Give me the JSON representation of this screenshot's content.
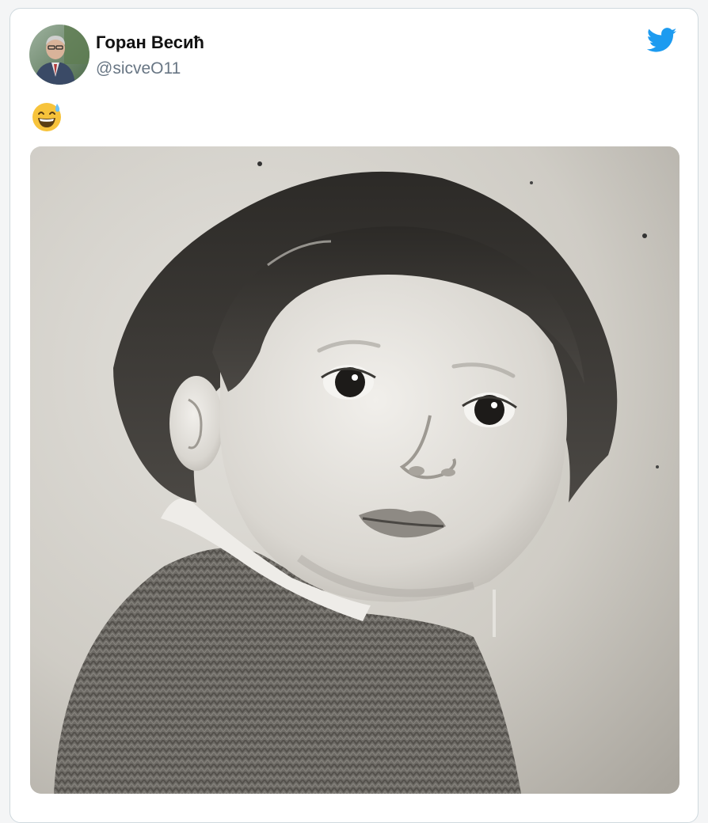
{
  "tweet": {
    "author": {
      "display_name": "Горан Весић",
      "handle": "@sicveO11"
    },
    "text_emoji": "grinning-face-with-sweat",
    "photo": {
      "subject": "black-and-white-photo"
    }
  },
  "colors": {
    "twitter_blue": "#1d9bf0",
    "handle_gray": "#687684",
    "card_border": "#cfd9de"
  },
  "icons": {
    "brand": "twitter-bird-icon",
    "emoji": "grinning-face-with-sweat-icon"
  }
}
